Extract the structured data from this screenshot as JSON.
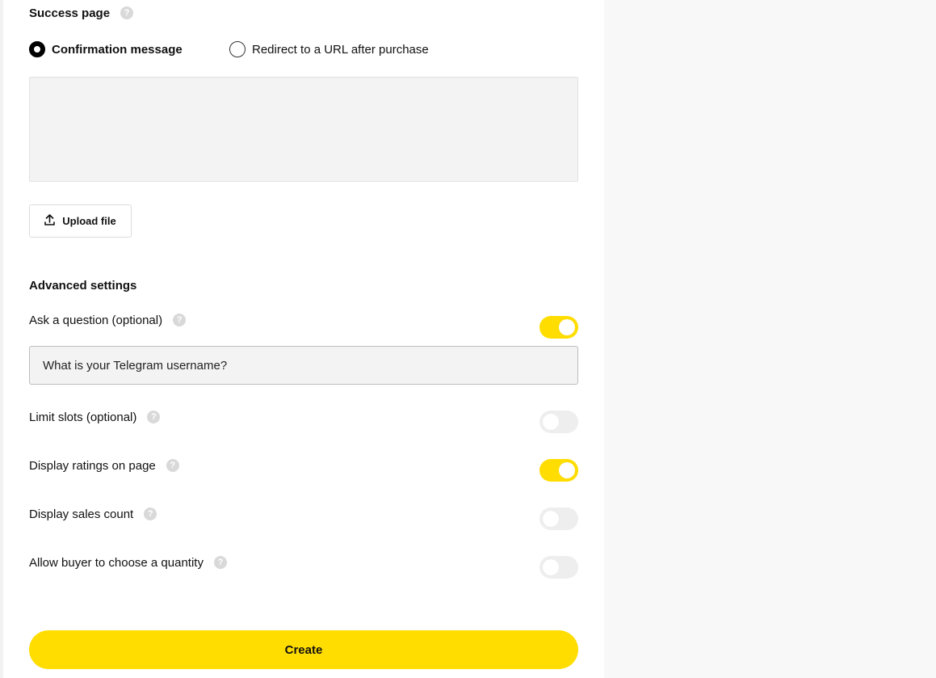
{
  "success_page": {
    "title": "Success page",
    "help": "?",
    "options": [
      {
        "label": "Confirmation message",
        "checked": true
      },
      {
        "label": "Redirect to a URL after purchase",
        "checked": false
      }
    ],
    "upload_label": "Upload file"
  },
  "advanced": {
    "title": "Advanced settings",
    "help": "?",
    "ask_question": {
      "label": "Ask a question (optional)",
      "enabled": true,
      "value": "What is your Telegram username?"
    },
    "limit_slots": {
      "label": "Limit slots (optional)",
      "enabled": false
    },
    "display_ratings": {
      "label": "Display ratings on page",
      "enabled": true
    },
    "display_sales": {
      "label": "Display sales count",
      "enabled": false
    },
    "allow_quantity": {
      "label": "Allow buyer to choose a quantity",
      "enabled": false
    }
  },
  "create_label": "Create",
  "colors": {
    "accent": "#ffdd00",
    "toggle_off": "#eeeeee",
    "panel": "#ffffff",
    "page": "#f8f8f8"
  },
  "icons": {
    "help": "question-circle-icon",
    "upload": "upload-arrow-icon"
  }
}
